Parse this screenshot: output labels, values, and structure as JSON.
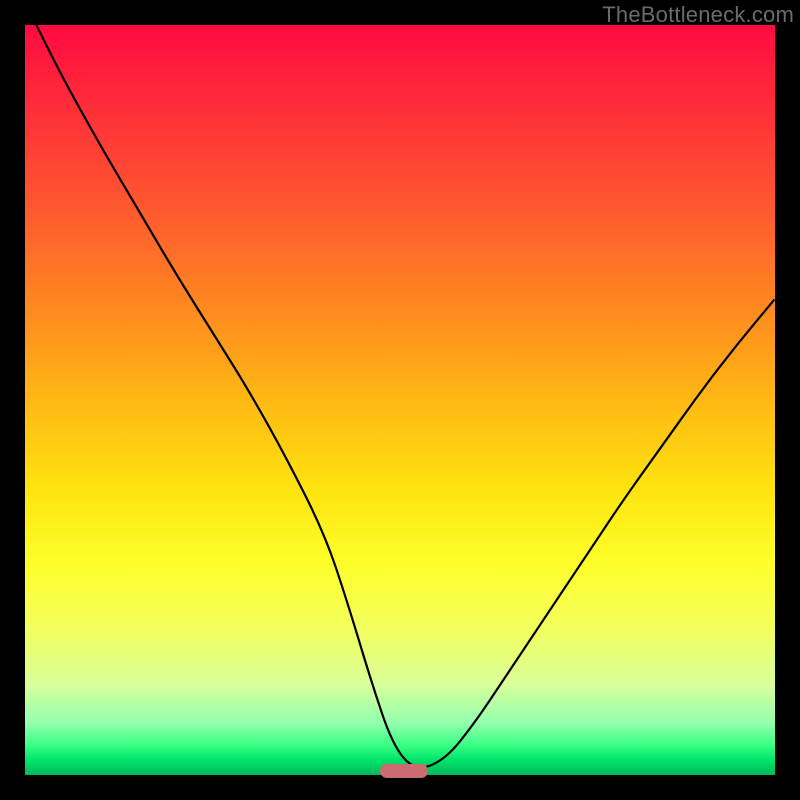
{
  "watermark": "TheBottleneck.com",
  "chart_data": {
    "type": "line",
    "title": "",
    "xlabel": "",
    "ylabel": "",
    "xlim": [
      0,
      100
    ],
    "ylim": [
      0,
      100
    ],
    "grid": false,
    "legend": false,
    "background_gradient": [
      {
        "stop": 0,
        "color": "#ff0b42"
      },
      {
        "stop": 25,
        "color": "#ff5a2f"
      },
      {
        "stop": 50,
        "color": "#ffb814"
      },
      {
        "stop": 72,
        "color": "#fdff2a"
      },
      {
        "stop": 88,
        "color": "#d8ff9a"
      },
      {
        "stop": 100,
        "color": "#00b85a"
      }
    ],
    "series": [
      {
        "name": "bottleneck-curve",
        "color": "#000000",
        "x": [
          1.5,
          5,
          10,
          15,
          20,
          25,
          30,
          35,
          40,
          43,
          46,
          49,
          52,
          56,
          60,
          64,
          68,
          72,
          76,
          80,
          85,
          90,
          95,
          100
        ],
        "y": [
          100,
          93,
          84,
          75.5,
          67,
          59,
          51,
          42,
          32,
          23,
          13,
          4,
          0.5,
          2,
          7,
          13,
          19,
          25,
          31,
          37,
          44,
          51,
          57.5,
          63.5
        ]
      }
    ],
    "annotations": [
      {
        "type": "marker",
        "name": "optimal-range",
        "x": 50.5,
        "y": 0.5,
        "color": "#cc6b70"
      }
    ]
  }
}
